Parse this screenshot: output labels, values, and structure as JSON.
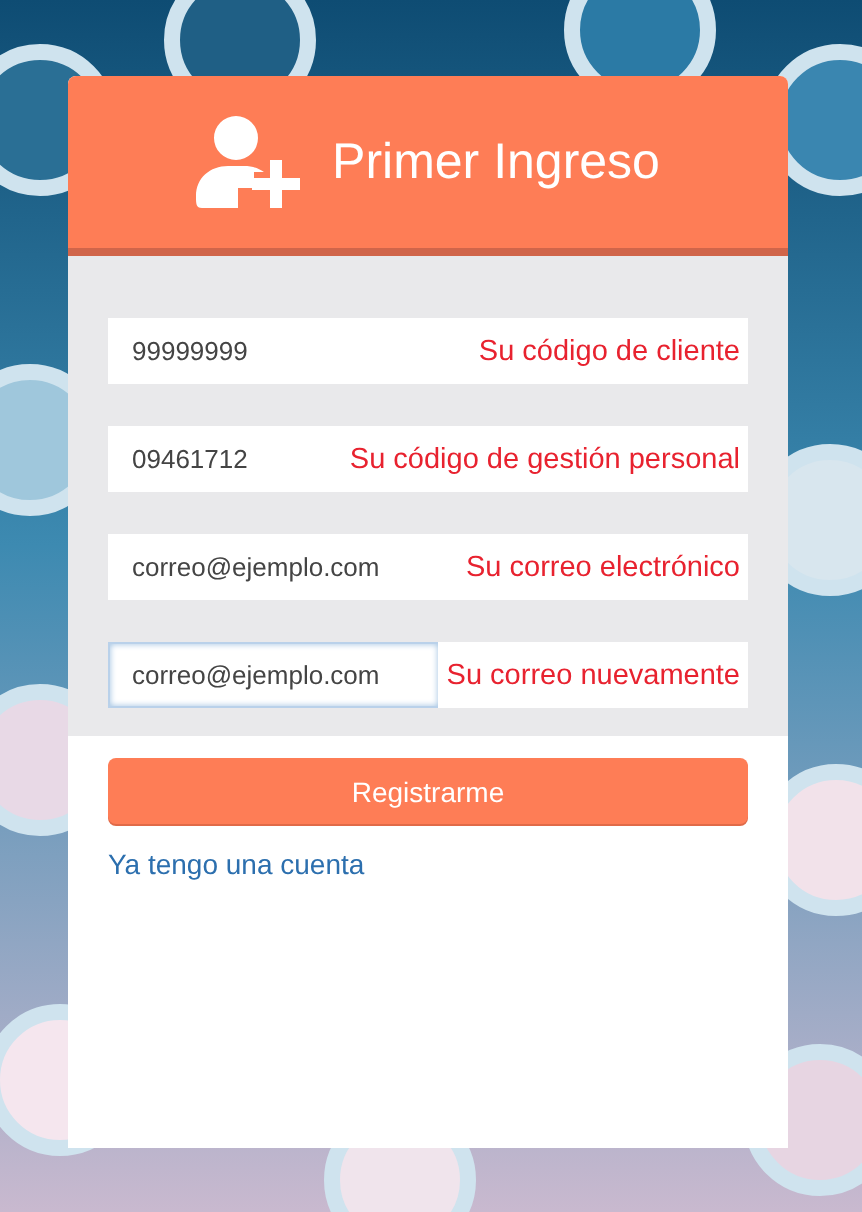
{
  "header": {
    "title": "Primer Ingreso"
  },
  "fields": [
    {
      "value": "99999999",
      "hint": "Su código de cliente",
      "focused": false
    },
    {
      "value": "09461712",
      "hint": "Su código de gestión personal",
      "focused": false
    },
    {
      "value": "correo@ejemplo.com",
      "hint": "Su correo electrónico",
      "focused": false
    },
    {
      "value": "correo@ejemplo.com",
      "hint": "Su correo nuevamente",
      "focused": true
    }
  ],
  "submit_button": "Registrarme",
  "login_link": "Ya tengo una cuenta"
}
